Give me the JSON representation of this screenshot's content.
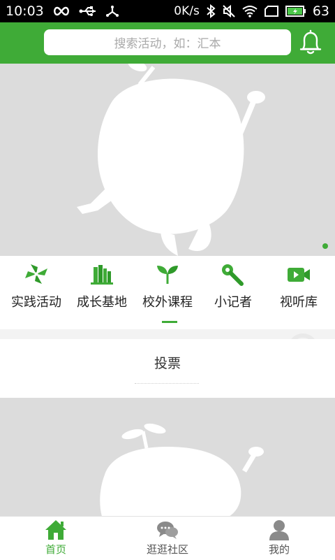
{
  "status_bar": {
    "time": "10:03",
    "net_speed": "0K/s",
    "battery": "63"
  },
  "header": {
    "search_placeholder": "搜索活动，如：汇本",
    "bell_icon": "bell-icon"
  },
  "categories": [
    {
      "label": "实践活动",
      "icon": "pinwheel-icon"
    },
    {
      "label": "成长基地",
      "icon": "books-icon"
    },
    {
      "label": "校外课程",
      "icon": "sprout-icon"
    },
    {
      "label": "小记者",
      "icon": "microphone-icon"
    },
    {
      "label": "视听库",
      "icon": "video-camera-icon"
    }
  ],
  "vote": {
    "title": "投票"
  },
  "tabbar": {
    "items": [
      {
        "label": "首页",
        "icon": "home-icon",
        "active": true
      },
      {
        "label": "逛逛社区",
        "icon": "chat-bubbles-icon",
        "active": false
      },
      {
        "label": "我的",
        "icon": "user-icon",
        "active": false
      }
    ]
  },
  "colors": {
    "brand_green": "#3fab37",
    "placeholder_grey": "#dcdcdc"
  }
}
